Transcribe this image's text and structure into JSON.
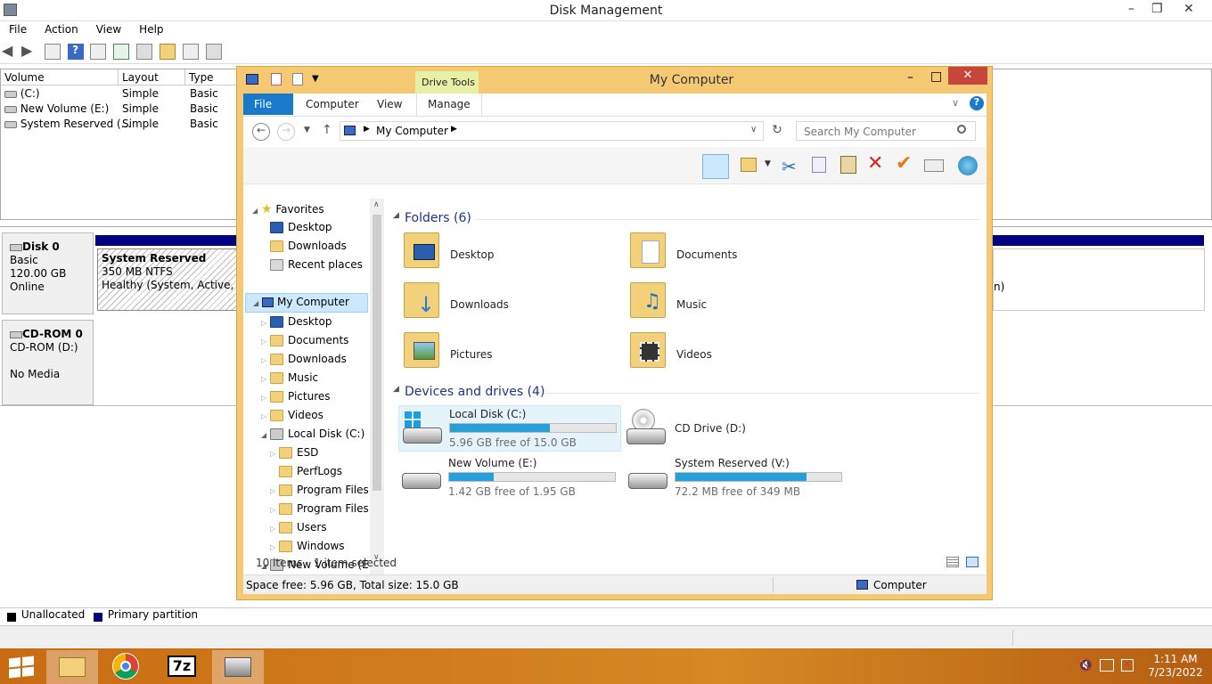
{
  "disk_mgmt": {
    "title": "Disk Management",
    "menu": [
      "File",
      "Action",
      "View",
      "Help"
    ],
    "columns": [
      "Volume",
      "Layout",
      "Type"
    ],
    "volumes": [
      {
        "name": "(C:)",
        "layout": "Simple",
        "type": "Basic"
      },
      {
        "name": "New Volume (E:)",
        "layout": "Simple",
        "type": "Basic"
      },
      {
        "name": "System Reserved (...",
        "layout": "Simple",
        "type": "Basic"
      }
    ],
    "disk0": {
      "name": "Disk 0",
      "kind": "Basic",
      "size": "120.00 GB",
      "status": "Online",
      "partition": {
        "name": "System Reserved",
        "detail": "350 MB NTFS",
        "health": "Healthy (System, Active, Prin"
      },
      "right_fragment": "n)"
    },
    "cdrom": {
      "name": "CD-ROM 0",
      "drive": "CD-ROM (D:)",
      "media": "No Media"
    },
    "legend": {
      "unallocated": "Unallocated",
      "primary": "Primary partition"
    }
  },
  "explorer": {
    "title": "My Computer",
    "context_tab": "Drive Tools",
    "tabs": [
      "File",
      "Computer",
      "View",
      "Manage"
    ],
    "address": "My Computer",
    "search_placeholder": "Search My Computer",
    "nav": {
      "favorites": "Favorites",
      "fav_items": [
        "Desktop",
        "Downloads",
        "Recent places"
      ],
      "computer": "My Computer",
      "comp_items": [
        "Desktop",
        "Documents",
        "Downloads",
        "Music",
        "Pictures",
        "Videos"
      ],
      "local_disk": "Local Disk (C:)",
      "disk_items": [
        "ESD",
        "PerfLogs",
        "Program Files",
        "Program Files (",
        "Users",
        "Windows"
      ],
      "new_volume": "New Volume (E:)"
    },
    "folders_header": "Folders (6)",
    "folders": [
      "Desktop",
      "Documents",
      "Downloads",
      "Music",
      "Pictures",
      "Videos"
    ],
    "devices_header": "Devices and drives (4)",
    "drives": [
      {
        "name": "Local Disk (C:)",
        "free": "5.96 GB free of 15.0 GB",
        "used": 0.6
      },
      {
        "name": "CD Drive (D:)",
        "free": "",
        "used": 0
      },
      {
        "name": "New Volume (E:)",
        "free": "1.42 GB free of 1.95 GB",
        "used": 0.27
      },
      {
        "name": "System Reserved (V:)",
        "free": "72.2 MB free of 349 MB",
        "used": 0.79
      }
    ],
    "status_items": "10 items",
    "status_selected": "1 item selected",
    "bottom_status": "Space free: 5.96 GB, Total size: 15.0 GB",
    "bottom_right": "Computer"
  },
  "taskbar": {
    "time": "1:11 AM",
    "date": "7/23/2022"
  }
}
